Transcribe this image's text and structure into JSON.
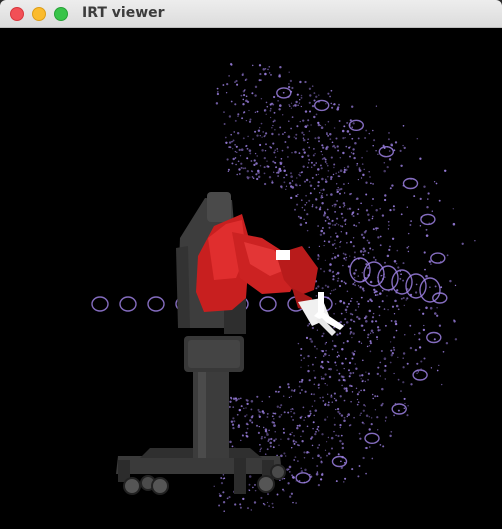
{
  "window": {
    "title": "IRT viewer",
    "controls": [
      "close",
      "minimize",
      "maximize"
    ],
    "colors": {
      "close": "#f25056",
      "minimize": "#fbbb2d",
      "maximize": "#38c449"
    }
  },
  "viewer": {
    "background": "#000000",
    "scene": {
      "robot": {
        "name": "robot-arm",
        "arm_color": "#d12424",
        "body_color": "#3a3a3a",
        "gripper_color": "#ffffff"
      },
      "workspace_points": {
        "name": "reachable-workspace-point-cloud",
        "color": "#9b7fe0"
      }
    }
  }
}
